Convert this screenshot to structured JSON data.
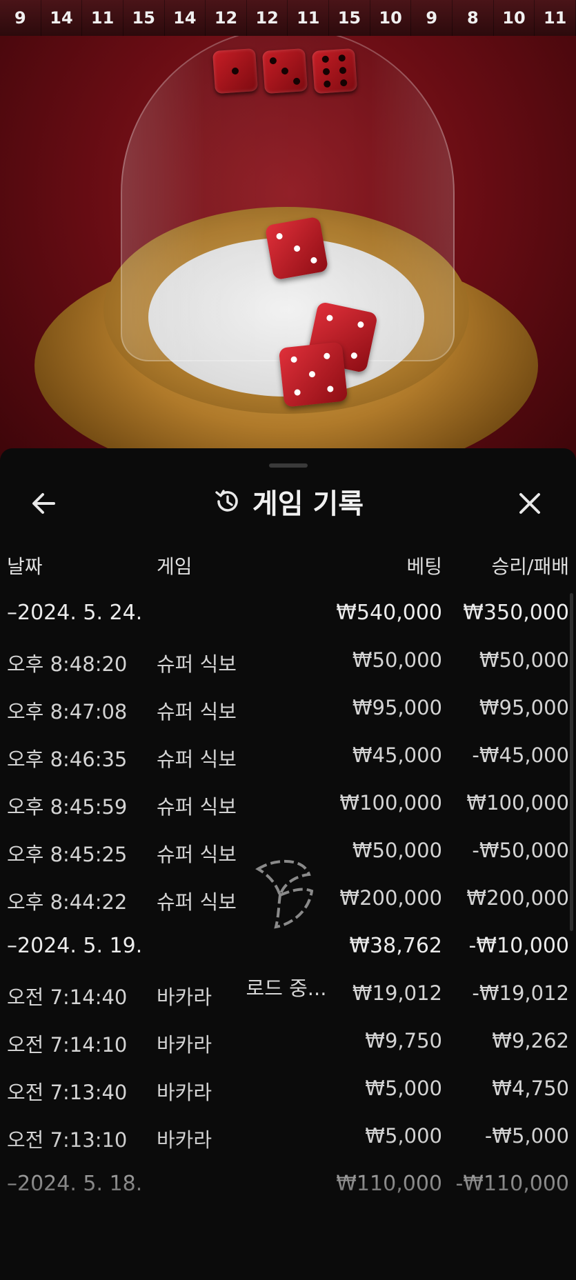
{
  "top_history": [
    "9",
    "14",
    "11",
    "15",
    "14",
    "12",
    "12",
    "11",
    "15",
    "10",
    "9",
    "8",
    "10",
    "11"
  ],
  "result_dice_faces": [
    1,
    3,
    6
  ],
  "panel": {
    "title": "게임 기록",
    "icons": {
      "back": "arrow-left-icon",
      "title": "history-icon",
      "close": "close-icon"
    }
  },
  "columns": {
    "date": "날짜",
    "game": "게임",
    "bet": "베팅",
    "winloss": "승리/패배"
  },
  "rows": [
    {
      "type": "group",
      "date": "–2024. 5. 24.",
      "game": "",
      "bet": "₩540,000",
      "winloss": "₩350,000"
    },
    {
      "type": "item",
      "date": "오후 8:48:20",
      "game": "슈퍼 식보",
      "bet": "₩50,000",
      "winloss": "₩50,000"
    },
    {
      "type": "item",
      "date": "오후 8:47:08",
      "game": "슈퍼 식보",
      "bet": "₩95,000",
      "winloss": "₩95,000"
    },
    {
      "type": "item",
      "date": "오후 8:46:35",
      "game": "슈퍼 식보",
      "bet": "₩45,000",
      "winloss": "-₩45,000"
    },
    {
      "type": "item",
      "date": "오후 8:45:59",
      "game": "슈퍼 식보",
      "bet": "₩100,000",
      "winloss": "₩100,000"
    },
    {
      "type": "item",
      "date": "오후 8:45:25",
      "game": "슈퍼 식보",
      "bet": "₩50,000",
      "winloss": "-₩50,000"
    },
    {
      "type": "item",
      "date": "오후 8:44:22",
      "game": "슈퍼 식보",
      "bet": "₩200,000",
      "winloss": "₩200,000"
    },
    {
      "type": "group",
      "date": "–2024. 5. 19.",
      "game": "",
      "bet": "₩38,762",
      "winloss": "-₩10,000"
    },
    {
      "type": "item",
      "date": "오전 7:14:40",
      "game": "바카라",
      "bet": "₩19,012",
      "winloss": "-₩19,012"
    },
    {
      "type": "item",
      "date": "오전 7:14:10",
      "game": "바카라",
      "bet": "₩9,750",
      "winloss": "₩9,262"
    },
    {
      "type": "item",
      "date": "오전 7:13:40",
      "game": "바카라",
      "bet": "₩5,000",
      "winloss": "₩4,750"
    },
    {
      "type": "item",
      "date": "오전 7:13:10",
      "game": "바카라",
      "bet": "₩5,000",
      "winloss": "-₩5,000"
    },
    {
      "type": "group",
      "date": "–2024. 5. 18.",
      "game": "",
      "bet": "₩110,000",
      "winloss": "-₩110,000"
    }
  ],
  "loading": {
    "text": "로드 중...",
    "icon": "loading-spinner-icon"
  }
}
